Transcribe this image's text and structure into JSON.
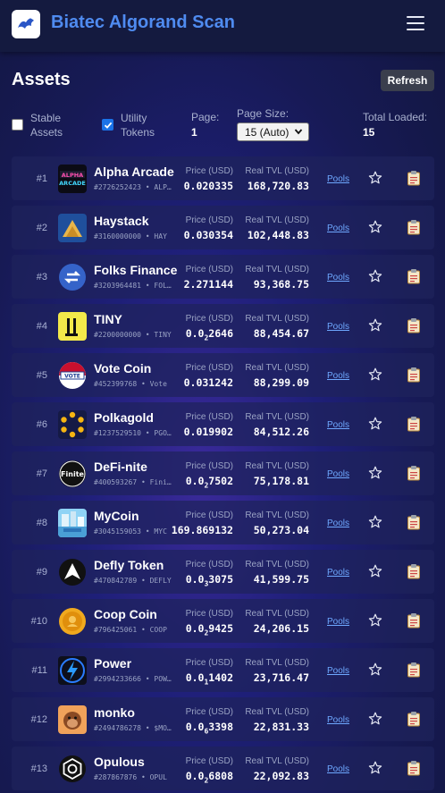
{
  "app": {
    "title": "Biatec Algorand Scan",
    "logo_icon": "biatec-logo-icon",
    "menu_icon": "hamburger-menu-icon"
  },
  "page": {
    "title": "Assets",
    "refresh_label": "Refresh"
  },
  "filters": {
    "stable": {
      "label_line1": "Stable",
      "label_line2": "Assets",
      "checked": false
    },
    "utility": {
      "label_line1": "Utility",
      "label_line2": "Tokens",
      "checked": true
    }
  },
  "meta": {
    "page_label": "Page:",
    "page_value": "1",
    "page_size_label": "Page Size:",
    "page_size_value": "15 (Auto)",
    "total_label": "Total Loaded:",
    "total_value": "15"
  },
  "columns": {
    "price": "Price (USD)",
    "tvl": "Real TVL (USD)",
    "pools": "Pools"
  },
  "assets": [
    {
      "rank": "#1",
      "name": "Alpha Arcade",
      "sub": "#2726252423 • ALPHA",
      "price_main": "0.020335",
      "price_sub": "",
      "price_tail": "",
      "tvl": "168,720.83",
      "icon": "alpha-arcade-icon"
    },
    {
      "rank": "#2",
      "name": "Haystack",
      "sub": "#3160000000 • HAY",
      "price_main": "0.030354",
      "price_sub": "",
      "price_tail": "",
      "tvl": "102,448.83",
      "icon": "haystack-icon"
    },
    {
      "rank": "#3",
      "name": "Folks Finance",
      "sub": "#3203964481 • FOLKS",
      "price_main": "2.271144",
      "price_sub": "",
      "price_tail": "",
      "tvl": "93,368.75",
      "icon": "folks-finance-icon"
    },
    {
      "rank": "#4",
      "name": "TINY",
      "sub": "#2200000000 • TINY",
      "price_main": "0.0",
      "price_sub": "2",
      "price_tail": "2646",
      "tvl": "88,454.67",
      "icon": "tiny-icon"
    },
    {
      "rank": "#5",
      "name": "Vote Coin",
      "sub": "#452399768 • Vote",
      "price_main": "0.031242",
      "price_sub": "",
      "price_tail": "",
      "tvl": "88,299.09",
      "icon": "vote-coin-icon"
    },
    {
      "rank": "#6",
      "name": "Polkagold",
      "sub": "#1237529510 • PGOLD",
      "price_main": "0.019902",
      "price_sub": "",
      "price_tail": "",
      "tvl": "84,512.26",
      "icon": "polkagold-icon"
    },
    {
      "rank": "#7",
      "name": "DeFi-nite",
      "sub": "#400593267 • Finite",
      "price_main": "0.0",
      "price_sub": "2",
      "price_tail": "7502",
      "tvl": "75,178.81",
      "icon": "defi-nite-icon"
    },
    {
      "rank": "#8",
      "name": "MyCoin",
      "sub": "#3045159053 • MYC",
      "price_main": "169.869132",
      "price_sub": "",
      "price_tail": "",
      "tvl": "50,273.04",
      "icon": "mycoin-icon"
    },
    {
      "rank": "#9",
      "name": "Defly Token",
      "sub": "#470842789 • DEFLY",
      "price_main": "0.0",
      "price_sub": "3",
      "price_tail": "3075",
      "tvl": "41,599.75",
      "icon": "defly-token-icon"
    },
    {
      "rank": "#10",
      "name": "Coop Coin",
      "sub": "#796425061 • COOP",
      "price_main": "0.0",
      "price_sub": "2",
      "price_tail": "9425",
      "tvl": "24,206.15",
      "icon": "coop-coin-icon"
    },
    {
      "rank": "#11",
      "name": "Power",
      "sub": "#2994233666 • POWER",
      "price_main": "0.0",
      "price_sub": "1",
      "price_tail": "1402",
      "tvl": "23,716.47",
      "icon": "power-icon"
    },
    {
      "rank": "#12",
      "name": "monko",
      "sub": "#2494786278 • $MONKO",
      "price_main": "0.0",
      "price_sub": "6",
      "price_tail": "3398",
      "tvl": "22,831.33",
      "icon": "monko-icon"
    },
    {
      "rank": "#13",
      "name": "Opulous",
      "sub": "#287867876 • OPUL",
      "price_main": "0.0",
      "price_sub": "2",
      "price_tail": "6808",
      "tvl": "22,092.83",
      "icon": "opulous-icon"
    }
  ],
  "colors": {
    "accent": "#4f8bf0",
    "link": "#6ea8ff",
    "topbar": "#141a3f",
    "row_bg": "#1e225c"
  }
}
